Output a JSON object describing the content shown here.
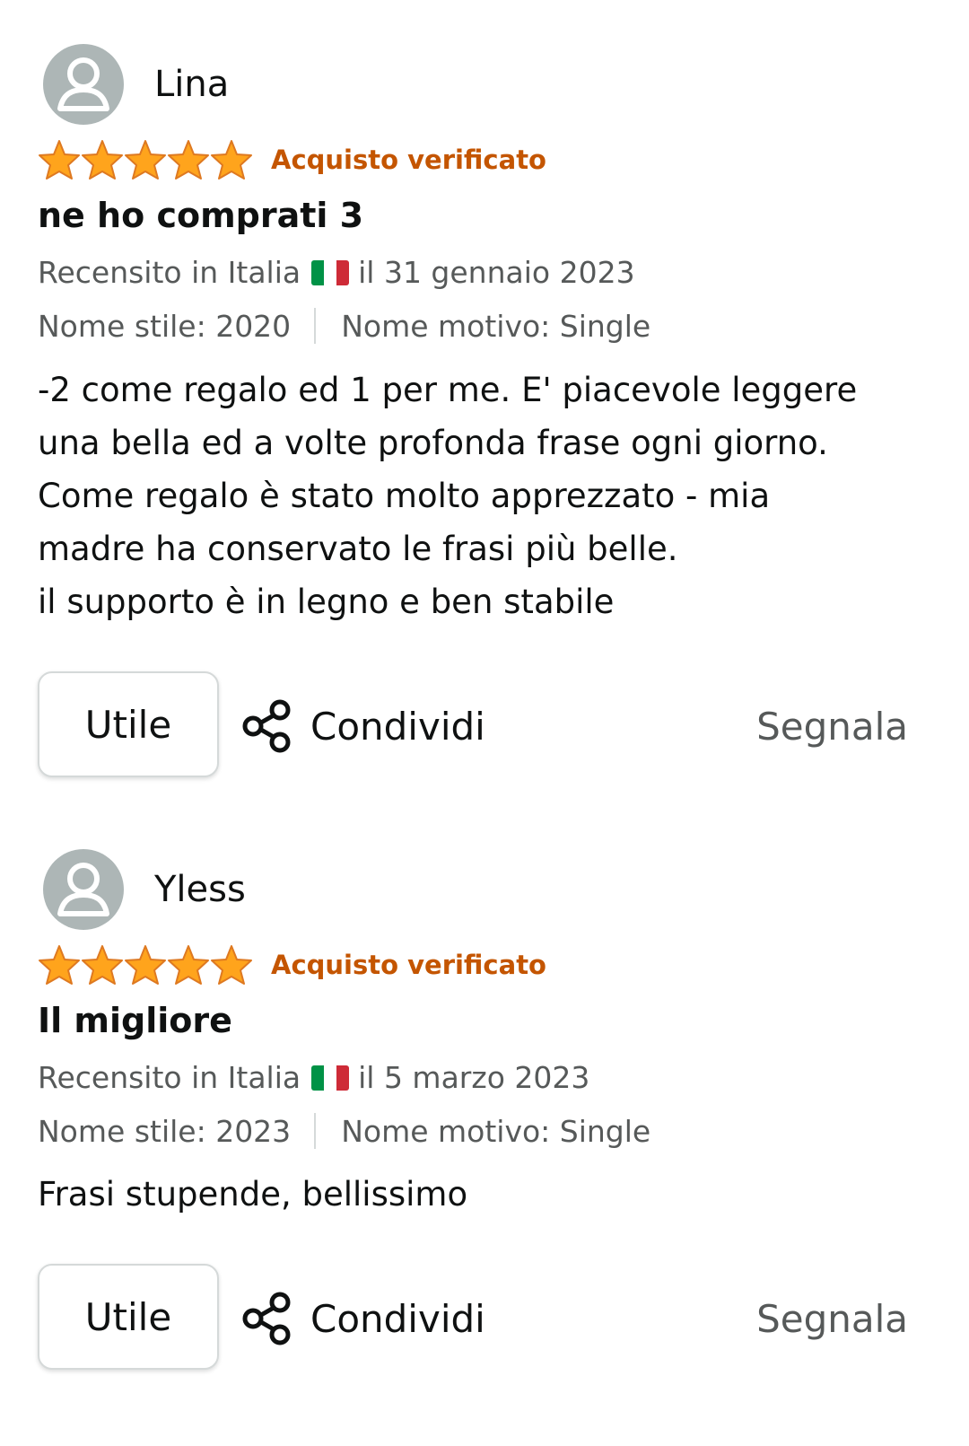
{
  "colors": {
    "star": "#ffa41c",
    "verified": "#c45500",
    "text_primary": "#0f1111",
    "text_secondary": "#565959",
    "avatar_bg": "#adb6b6"
  },
  "reviews": [
    {
      "reviewer": "Lina",
      "rating": 5,
      "rating_max": 5,
      "verified_label": "Acquisto verificato",
      "title": "ne ho comprati 3",
      "reviewed_in_prefix": "Recensito in Italia",
      "reviewed_in_flag": "italy-flag-icon",
      "reviewed_date": "il 31 gennaio 2023",
      "style_name": "Nome stile: 2020",
      "pattern_name": "Nome motivo: Single",
      "body_lines": [
        "-2 come regalo ed 1 per me. E' piacevole leggere",
        "una bella ed a volte profonda frase ogni giorno.",
        "Come regalo è stato molto apprezzato - mia",
        "madre ha conservato le frasi più belle.",
        "il supporto è in legno e ben stabile"
      ],
      "helpful_label": "Utile",
      "share_label": "Condividi",
      "report_label": "Segnala"
    },
    {
      "reviewer": "Yless",
      "rating": 5,
      "rating_max": 5,
      "verified_label": "Acquisto verificato",
      "title": "Il migliore",
      "reviewed_in_prefix": "Recensito in Italia",
      "reviewed_in_flag": "italy-flag-icon",
      "reviewed_date": "il 5 marzo 2023",
      "style_name": "Nome stile: 2023",
      "pattern_name": "Nome motivo: Single",
      "body_lines": [
        "Frasi stupende, bellissimo"
      ],
      "helpful_label": "Utile",
      "share_label": "Condividi",
      "report_label": "Segnala"
    }
  ]
}
